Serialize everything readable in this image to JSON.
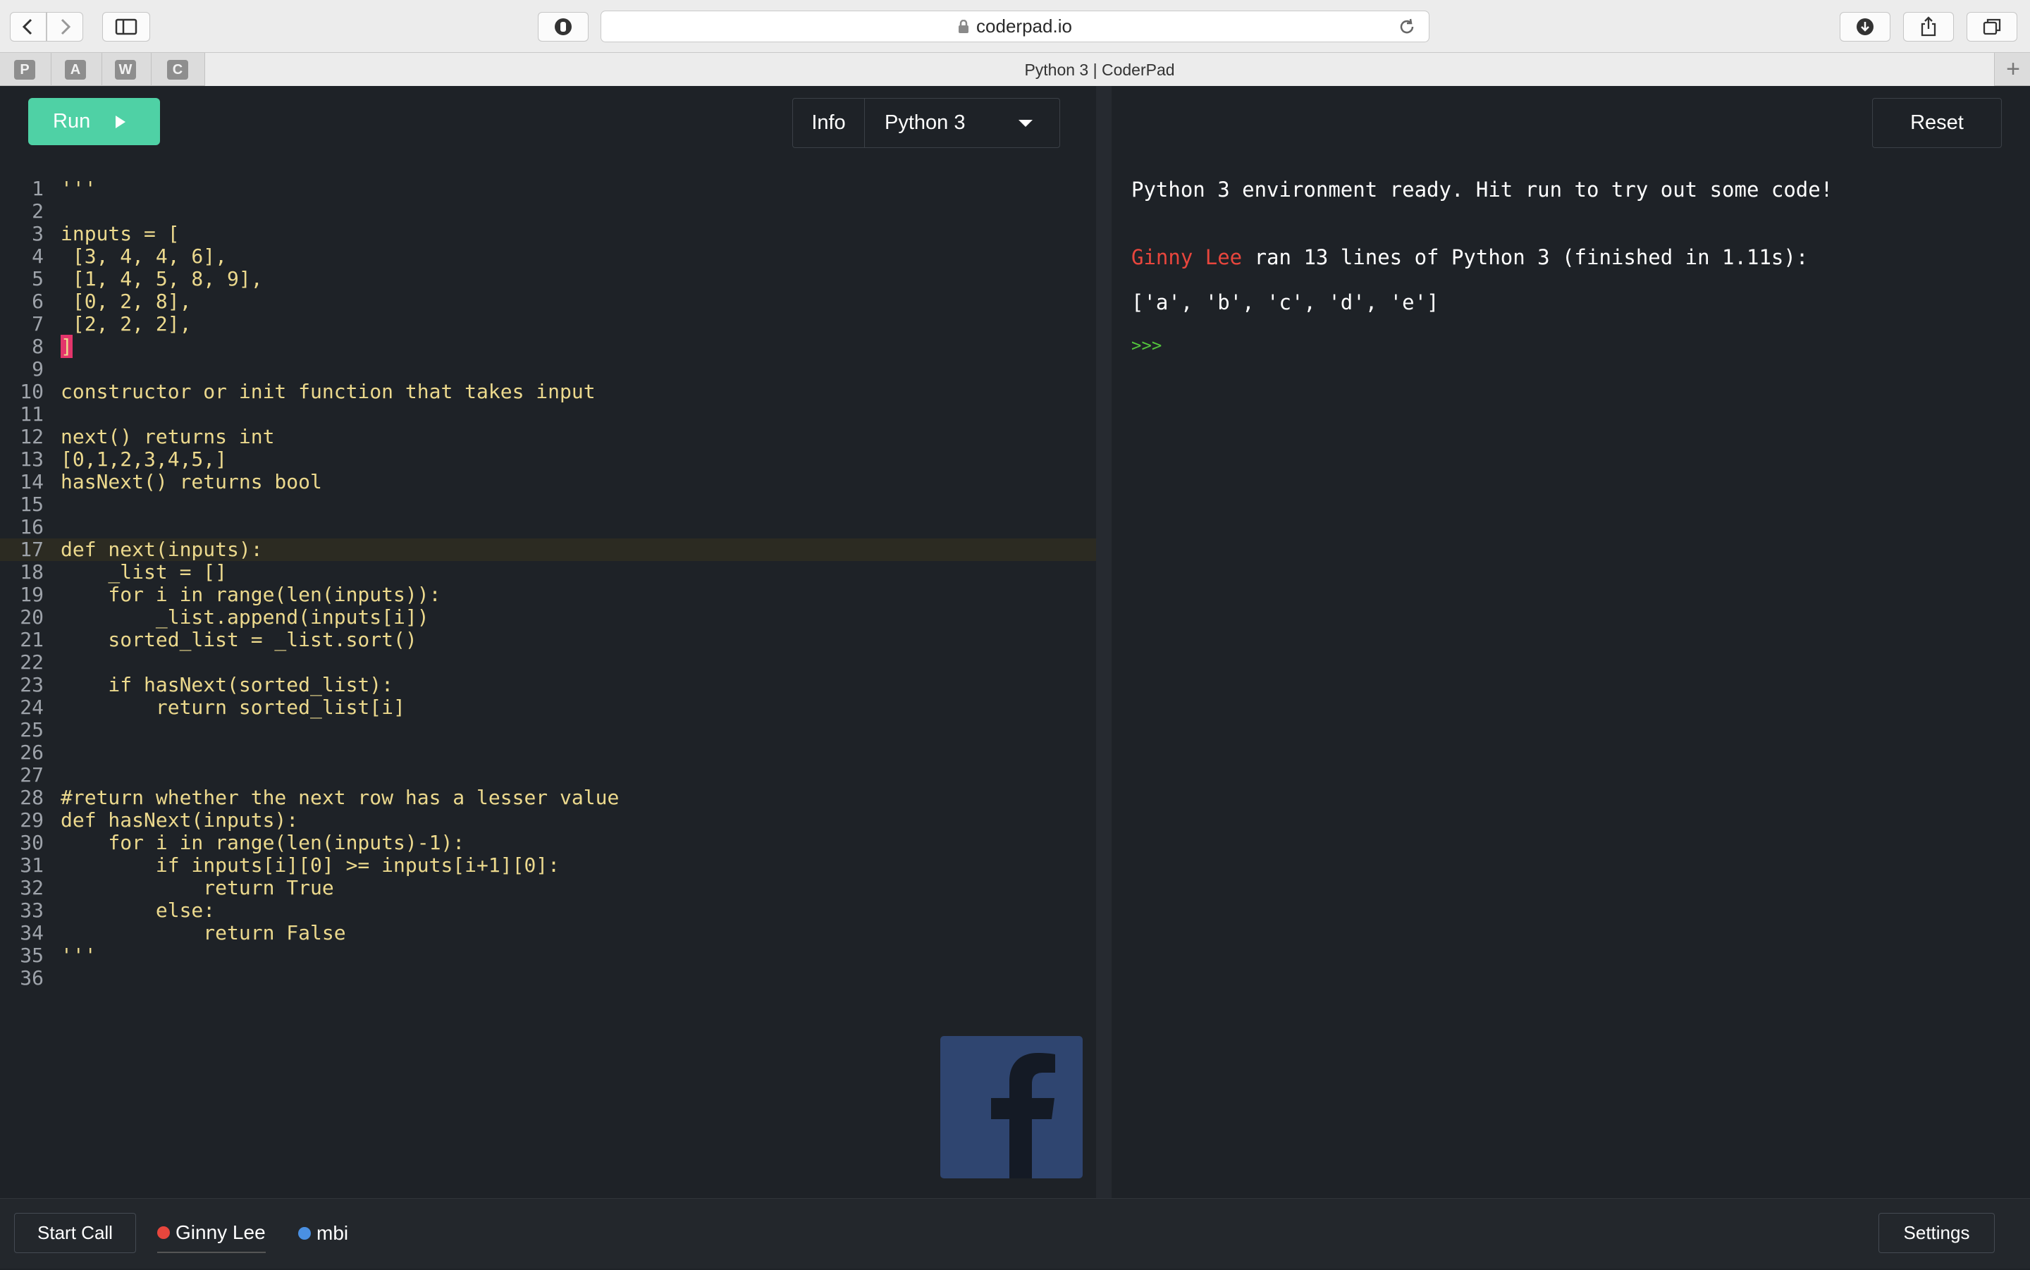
{
  "browser": {
    "url": "coderpad.io",
    "tab_title": "Python 3 | CoderPad",
    "favorites": [
      "P",
      "A",
      "W",
      "C"
    ]
  },
  "toolbar": {
    "run_label": "Run",
    "info_label": "Info",
    "language": "Python 3",
    "reset_label": "Reset"
  },
  "editor": {
    "current_line": 17,
    "cursor_line": 8,
    "lines": [
      "'''",
      "",
      "inputs = [",
      " [3, 4, 4, 6],",
      " [1, 4, 5, 8, 9],",
      " [0, 2, 8],",
      " [2, 2, 2],",
      "]",
      "",
      "constructor or init function that takes input",
      "",
      "next() returns int",
      "[0,1,2,3,4,5,]",
      "hasNext() returns bool",
      "",
      "",
      "def next(inputs):",
      "    _list = []",
      "    for i in range(len(inputs)):",
      "        _list.append(inputs[i])",
      "    sorted_list = _list.sort()",
      "",
      "    if hasNext(sorted_list):",
      "        return sorted_list[i]",
      "",
      "",
      "",
      "#return whether the next row has a lesser value",
      "def hasNext(inputs):",
      "    for i in range(len(inputs)-1):",
      "        if inputs[i][0] >= inputs[i+1][0]:",
      "            return True",
      "        else:",
      "            return False",
      "'''",
      ""
    ]
  },
  "console": {
    "ready_message": "Python 3 environment ready. Hit run to try out some code!",
    "run_user": "Ginny Lee",
    "run_message": " ran 13 lines of Python 3 (finished in 1.11s):",
    "output": "['a', 'b', 'c', 'd', 'e']",
    "prompt": ">>>"
  },
  "footer": {
    "start_call_label": "Start Call",
    "users": [
      {
        "name": "Ginny Lee",
        "color": "#e8463d"
      },
      {
        "name": "mbi",
        "color": "#4a90e2"
      }
    ],
    "settings_label": "Settings"
  },
  "colors": {
    "run_button": "#4fd1a5",
    "code_text": "#ecd98d",
    "cursor": "#e3356b",
    "facebook_logo": "#2f4570"
  }
}
